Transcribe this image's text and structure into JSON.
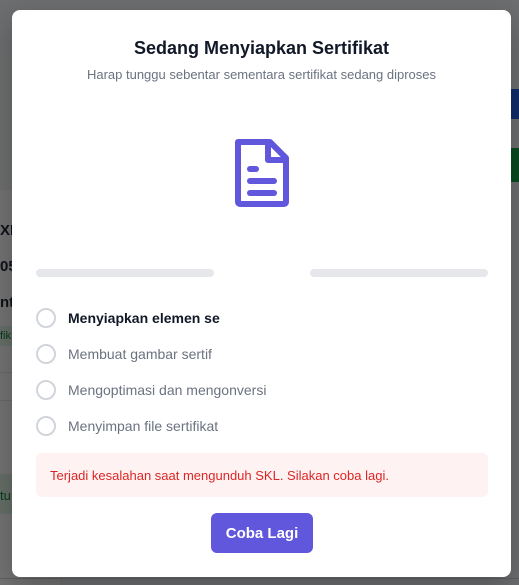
{
  "background": {
    "text_lines": [
      "XI",
      "05",
      "nt",
      "fik",
      "tu"
    ]
  },
  "modal": {
    "title": "Sedang Menyiapkan Sertifikat",
    "subtitle": "Harap tunggu sebentar sementara sertifikat sedang diproses",
    "icon": "document-icon",
    "accent_color": "#6157dc",
    "steps": [
      {
        "label": "Menyiapkan elemen se",
        "state": "active"
      },
      {
        "label": "Membuat gambar sertif",
        "state": "pending"
      },
      {
        "label": "Mengoptimasi dan mengonversi",
        "state": "pending"
      },
      {
        "label": "Menyimpan file sertifikat",
        "state": "pending"
      }
    ],
    "error_message": "Terjadi kesalahan saat mengunduh SKL. Silakan coba lagi.",
    "error_color": "#dc2626",
    "retry_label": "Coba Lagi"
  }
}
